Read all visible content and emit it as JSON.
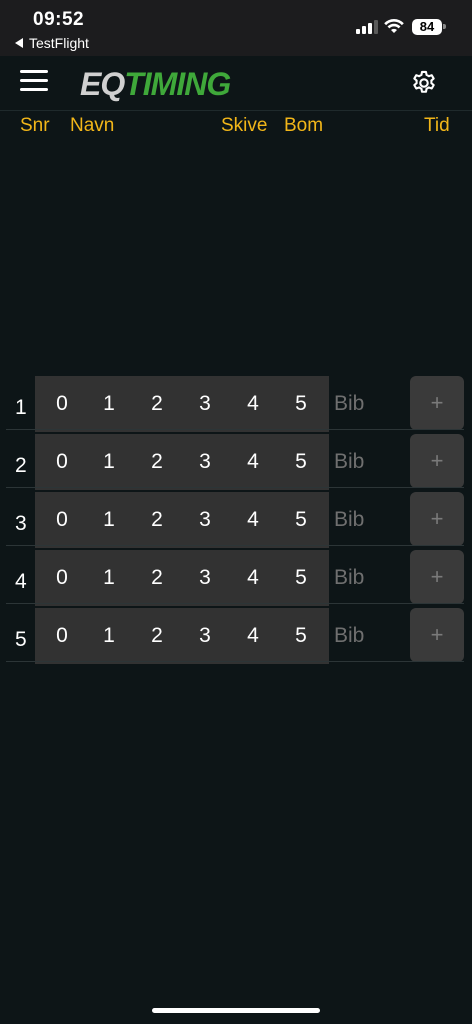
{
  "status_bar": {
    "time": "09:52",
    "back_app": "TestFlight",
    "battery": "84"
  },
  "header": {
    "logo_eq": "EQ",
    "logo_timing": "TIMING",
    "menu_icon": "hamburger-menu-icon",
    "settings_icon": "gear-icon"
  },
  "columns": {
    "snr": "Snr",
    "navn": "Navn",
    "skive": "Skive",
    "bom": "Bom",
    "tid": "Tid"
  },
  "colors": {
    "accent": "#f2b619",
    "logo_green": "#3fa83a",
    "background": "#0d1517"
  },
  "rows": [
    {
      "num": "1",
      "scores": [
        "0",
        "1",
        "2",
        "3",
        "4",
        "5"
      ],
      "bib_placeholder": "Bib",
      "add": "+"
    },
    {
      "num": "2",
      "scores": [
        "0",
        "1",
        "2",
        "3",
        "4",
        "5"
      ],
      "bib_placeholder": "Bib",
      "add": "+"
    },
    {
      "num": "3",
      "scores": [
        "0",
        "1",
        "2",
        "3",
        "4",
        "5"
      ],
      "bib_placeholder": "Bib",
      "add": "+"
    },
    {
      "num": "4",
      "scores": [
        "0",
        "1",
        "2",
        "3",
        "4",
        "5"
      ],
      "bib_placeholder": "Bib",
      "add": "+"
    },
    {
      "num": "5",
      "scores": [
        "0",
        "1",
        "2",
        "3",
        "4",
        "5"
      ],
      "bib_placeholder": "Bib",
      "add": "+"
    }
  ]
}
